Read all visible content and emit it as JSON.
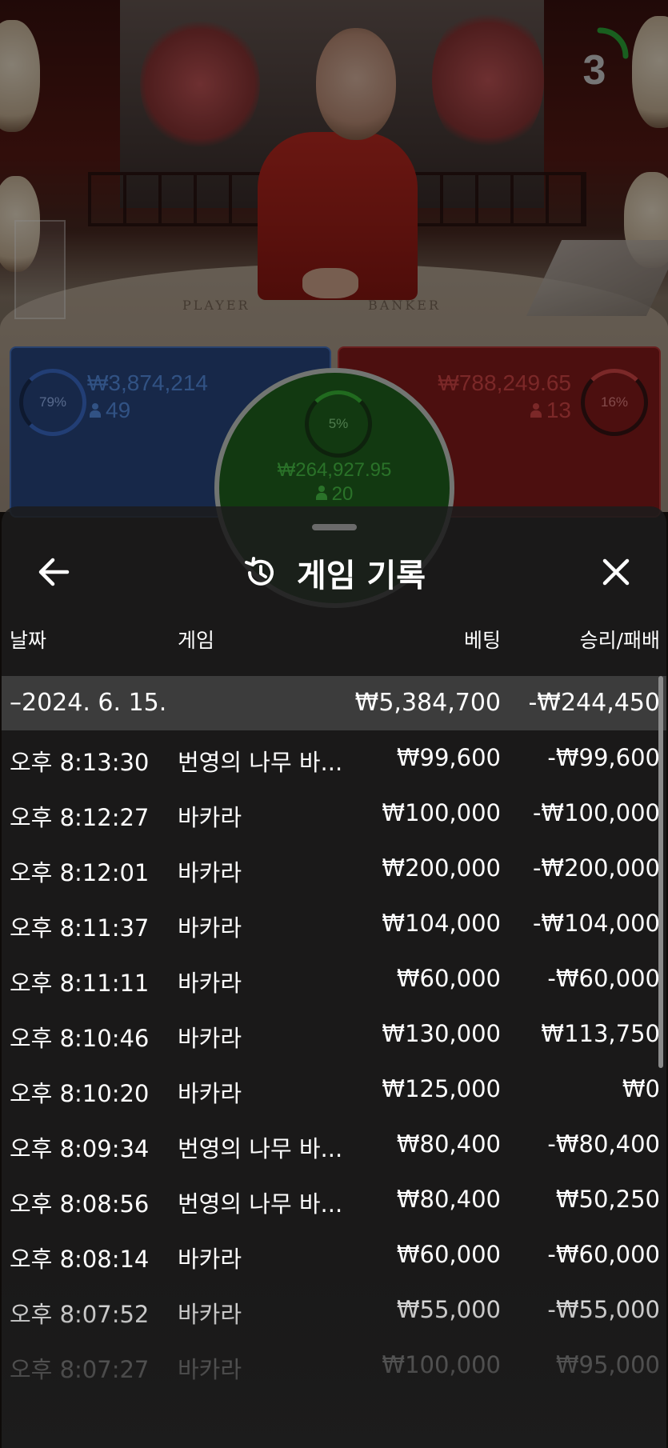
{
  "table": {
    "felt_player": "PLAYER",
    "felt_banker": "BANKER",
    "countdown": "3"
  },
  "bets": {
    "player": {
      "percent": "79%",
      "amount": "₩3,874,214",
      "players": "49",
      "color": "#2a4a86"
    },
    "tie": {
      "percent": "5%",
      "amount": "₩264,927.95",
      "players": "20",
      "color": "#21691f"
    },
    "banker": {
      "percent": "16%",
      "amount": "₩788,249.65",
      "players": "13",
      "color": "#8a1c1c"
    }
  },
  "history_sheet": {
    "title": "게임 기록",
    "back_icon": "arrow-left-icon",
    "close_icon": "close-icon",
    "title_icon": "history-icon",
    "columns": {
      "date": "날짜",
      "game": "게임",
      "bet": "베팅",
      "win_loss": "승리/패배"
    },
    "date_group": {
      "date": "2024. 6. 15.",
      "bet": "₩5,384,700",
      "win_loss": "-₩244,450"
    },
    "rows": [
      {
        "time": "오후 8:13:30",
        "game": "번영의 나무 바...",
        "bet": "₩99,600",
        "win_loss": "-₩99,600"
      },
      {
        "time": "오후 8:12:27",
        "game": "바카라",
        "bet": "₩100,000",
        "win_loss": "-₩100,000"
      },
      {
        "time": "오후 8:12:01",
        "game": "바카라",
        "bet": "₩200,000",
        "win_loss": "-₩200,000"
      },
      {
        "time": "오후 8:11:37",
        "game": "바카라",
        "bet": "₩104,000",
        "win_loss": "-₩104,000"
      },
      {
        "time": "오후 8:11:11",
        "game": "바카라",
        "bet": "₩60,000",
        "win_loss": "-₩60,000"
      },
      {
        "time": "오후 8:10:46",
        "game": "바카라",
        "bet": "₩130,000",
        "win_loss": "₩113,750"
      },
      {
        "time": "오후 8:10:20",
        "game": "바카라",
        "bet": "₩125,000",
        "win_loss": "₩0"
      },
      {
        "time": "오후 8:09:34",
        "game": "번영의 나무 바...",
        "bet": "₩80,400",
        "win_loss": "-₩80,400"
      },
      {
        "time": "오후 8:08:56",
        "game": "번영의 나무 바...",
        "bet": "₩80,400",
        "win_loss": "₩50,250"
      },
      {
        "time": "오후 8:08:14",
        "game": "바카라",
        "bet": "₩60,000",
        "win_loss": "-₩60,000"
      },
      {
        "time": "오후 8:07:52",
        "game": "바카라",
        "bet": "₩55,000",
        "win_loss": "-₩55,000"
      },
      {
        "time": "오후 8:07:27",
        "game": "바카라",
        "bet": "₩100,000",
        "win_loss": "₩95,000"
      }
    ]
  }
}
